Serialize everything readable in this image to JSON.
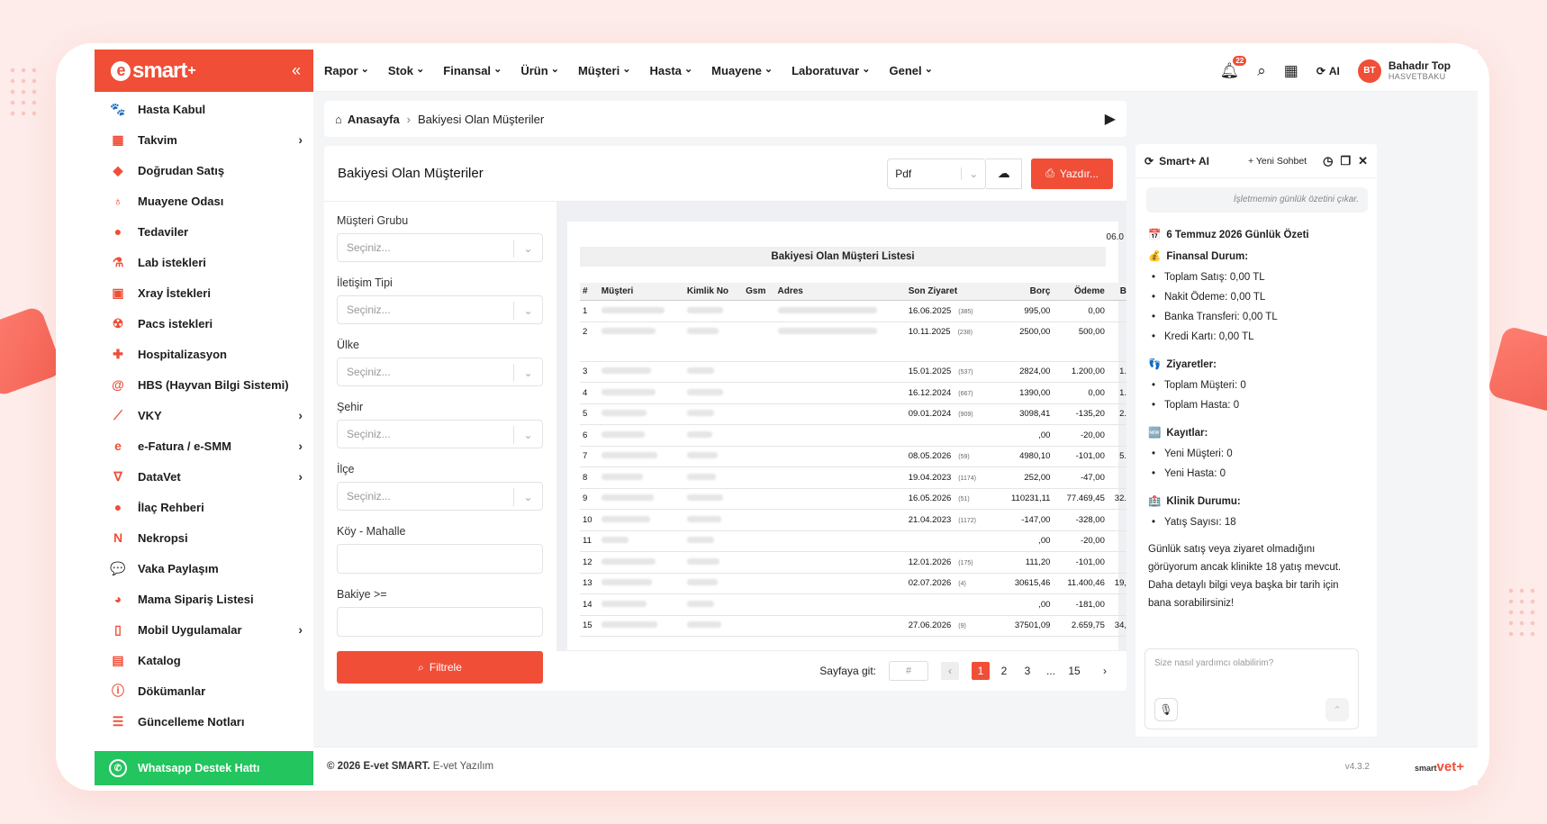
{
  "brand": {
    "name": "smart",
    "plus": "+",
    "collapse": "«"
  },
  "sidebar": {
    "items": [
      {
        "label": "Hasta Kabul",
        "icon": "paw-icon",
        "glyph": "🐾",
        "chev": false
      },
      {
        "label": "Takvim",
        "icon": "calendar-icon",
        "glyph": "▦",
        "chev": true
      },
      {
        "label": "Doğrudan Satış",
        "icon": "tag-icon",
        "glyph": "◆",
        "chev": false
      },
      {
        "label": "Muayene Odası",
        "icon": "stethoscope-icon",
        "glyph": "♁",
        "chev": false
      },
      {
        "label": "Tedaviler",
        "icon": "pills-icon",
        "glyph": "●",
        "chev": false
      },
      {
        "label": "Lab istekleri",
        "icon": "flask-icon",
        "glyph": "⚗",
        "chev": false
      },
      {
        "label": "Xray İstekleri",
        "icon": "xray-icon",
        "glyph": "▣",
        "chev": false
      },
      {
        "label": "Pacs istekleri",
        "icon": "radiation-icon",
        "glyph": "☢",
        "chev": false
      },
      {
        "label": "Hospitalizasyon",
        "icon": "hospital-icon",
        "glyph": "✚",
        "chev": false
      },
      {
        "label": "HBS (Hayvan Bilgi Sistemi)",
        "icon": "at-icon",
        "glyph": "@",
        "chev": false
      },
      {
        "label": "VKY",
        "icon": "chart-line-icon",
        "glyph": "⟋",
        "chev": true
      },
      {
        "label": "e-Fatura / e-SMM",
        "icon": "invoice-icon",
        "glyph": "e",
        "chev": true
      },
      {
        "label": "DataVet",
        "icon": "datavet-icon",
        "glyph": "∇",
        "chev": true
      },
      {
        "label": "İlaç Rehberi",
        "icon": "medicine-icon",
        "glyph": "●",
        "chev": false
      },
      {
        "label": "Nekropsi",
        "icon": "n-icon",
        "glyph": "N",
        "chev": false
      },
      {
        "label": "Vaka Paylaşım",
        "icon": "chat-icon",
        "glyph": "💬",
        "chev": false
      },
      {
        "label": "Mama Sipariş Listesi",
        "icon": "food-icon",
        "glyph": "◕",
        "chev": false
      },
      {
        "label": "Mobil Uygulamalar",
        "icon": "tablet-icon",
        "glyph": "▯",
        "chev": true
      },
      {
        "label": "Katalog",
        "icon": "catalog-icon",
        "glyph": "▤",
        "chev": false
      },
      {
        "label": "Dökümanlar",
        "icon": "info-icon",
        "glyph": "ⓘ",
        "chev": false
      },
      {
        "label": "Güncelleme Notları",
        "icon": "list-icon",
        "glyph": "☰",
        "chev": false
      }
    ],
    "whatsapp": "Whatsapp Destek Hattı"
  },
  "topnav": {
    "items": [
      "Rapor",
      "Stok",
      "Finansal",
      "Ürün",
      "Müşteri",
      "Hasta",
      "Muayene",
      "Laboratuvar",
      "Genel"
    ],
    "notif_count": "22",
    "ai_label": "AI",
    "user_initials": "BT",
    "user_name": "Bahadır Top",
    "user_clinic": "HASVETBAKU"
  },
  "breadcrumb": {
    "home": "Anasayfa",
    "sep": "›",
    "current": "Bakiyesi Olan Müşteriler"
  },
  "panel": {
    "title": "Bakiyesi Olan Müşteriler",
    "format": "Pdf",
    "print": "Yazdır..."
  },
  "filters": {
    "fields": [
      {
        "label": "Müşteri Grubu",
        "type": "select",
        "placeholder": "Seçiniz..."
      },
      {
        "label": "İletişim Tipi",
        "type": "select",
        "placeholder": "Seçiniz..."
      },
      {
        "label": "Ülke",
        "type": "select",
        "placeholder": "Seçiniz..."
      },
      {
        "label": "Şehir",
        "type": "select",
        "placeholder": "Seçiniz..."
      },
      {
        "label": "İlçe",
        "type": "select",
        "placeholder": "Seçiniz..."
      },
      {
        "label": "Köy - Mahalle",
        "type": "input",
        "placeholder": ""
      },
      {
        "label": "Bakiye >=",
        "type": "input",
        "placeholder": ""
      }
    ],
    "button": "Filtrele"
  },
  "report": {
    "date": "06.0",
    "title": "Bakiyesi Olan Müşteri Listesi",
    "columns": [
      "#",
      "Müşteri",
      "Kimlik No",
      "Gsm",
      "Adres",
      "Son Ziyaret",
      "Borç",
      "Ödeme",
      "B"
    ],
    "rows": [
      {
        "n": "1",
        "date": "16.06.2025",
        "visits": "(385)",
        "borc": "995,00",
        "odeme": "0,00",
        "b": "",
        "tall": false
      },
      {
        "n": "2",
        "date": "10.11.2025",
        "visits": "(238)",
        "borc": "2500,00",
        "odeme": "500,00",
        "b": "",
        "tall": true
      },
      {
        "n": "3",
        "date": "15.01.2025",
        "visits": "(537)",
        "borc": "2824,00",
        "odeme": "1.200,00",
        "b": "1.",
        "tall": false
      },
      {
        "n": "4",
        "date": "16.12.2024",
        "visits": "(667)",
        "borc": "1390,00",
        "odeme": "0,00",
        "b": "1.",
        "tall": false
      },
      {
        "n": "5",
        "date": "09.01.2024",
        "visits": "(909)",
        "borc": "3098,41",
        "odeme": "-135,20",
        "b": "2.",
        "tall": false
      },
      {
        "n": "6",
        "date": "",
        "visits": "",
        "borc": ",00",
        "odeme": "-20,00",
        "b": "",
        "tall": false
      },
      {
        "n": "7",
        "date": "08.05.2026",
        "visits": "(59)",
        "borc": "4980,10",
        "odeme": "-101,00",
        "b": "5.",
        "tall": false
      },
      {
        "n": "8",
        "date": "19.04.2023",
        "visits": "(1174)",
        "borc": "252,00",
        "odeme": "-47,00",
        "b": "",
        "tall": false
      },
      {
        "n": "9",
        "date": "16.05.2026",
        "visits": "(51)",
        "borc": "110231,11",
        "odeme": "77.469,45",
        "b": "32.",
        "tall": false
      },
      {
        "n": "10",
        "date": "21.04.2023",
        "visits": "(1172)",
        "borc": "-147,00",
        "odeme": "-328,00",
        "b": "",
        "tall": false
      },
      {
        "n": "11",
        "date": "",
        "visits": "",
        "borc": ",00",
        "odeme": "-20,00",
        "b": "",
        "tall": false
      },
      {
        "n": "12",
        "date": "12.01.2026",
        "visits": "(175)",
        "borc": "111,20",
        "odeme": "-101,00",
        "b": "",
        "tall": false
      },
      {
        "n": "13",
        "date": "02.07.2026",
        "visits": "(4)",
        "borc": "30615,46",
        "odeme": "11.400,46",
        "b": "19,",
        "tall": false
      },
      {
        "n": "14",
        "date": "",
        "visits": "",
        "borc": ",00",
        "odeme": "-181,00",
        "b": "",
        "tall": false
      },
      {
        "n": "15",
        "date": "27.06.2026",
        "visits": "(9)",
        "borc": "37501,09",
        "odeme": "2.659,75",
        "b": "34,",
        "tall": false
      }
    ]
  },
  "pager": {
    "goto_label": "Sayfaya git:",
    "goto_placeholder": "#",
    "pages": [
      "1",
      "2",
      "3",
      "...",
      "15"
    ],
    "active": "1"
  },
  "ai": {
    "title": "Smart+ AI",
    "new_chat": "+ Yeni Sohbet",
    "prompt": "İşletmemin günlük özetini çıkar.",
    "summary_title": "6 Temmuz 2026 Günlük Özeti",
    "sections": [
      {
        "title": "Finansal Durum:",
        "icon": "💰",
        "items": [
          "Toplam Satış: 0,00 TL",
          "Nakit Ödeme: 0,00 TL",
          "Banka Transferi: 0,00 TL",
          "Kredi Kartı: 0,00 TL"
        ]
      },
      {
        "title": "Ziyaretler:",
        "icon": "👣",
        "items": [
          "Toplam Müşteri: 0",
          "Toplam Hasta: 0"
        ]
      },
      {
        "title": "Kayıtlar:",
        "icon": "🆕",
        "items": [
          "Yeni Müşteri: 0",
          "Yeni Hasta: 0"
        ]
      },
      {
        "title": "Klinik Durumu:",
        "icon": "🏥",
        "items": [
          "Yatış Sayısı: 18"
        ]
      }
    ],
    "conclusion": "Günlük satış veya ziyaret olmadığını görüyorum ancak klinikte 18 yatış mevcut. Daha detaylı bilgi veya başka bir tarih için bana sorabilirsiniz!",
    "input_placeholder": "Size nasıl yardımcı olabilirim?"
  },
  "footer": {
    "copyright": "© 2026 E-vet SMART.",
    "company": "E-vet Yazılım",
    "version": "v4.3.2",
    "logo_a": "smart",
    "logo_b": "vet+"
  },
  "colors": {
    "accent": "#f04e37",
    "whatsapp": "#22c55e"
  }
}
